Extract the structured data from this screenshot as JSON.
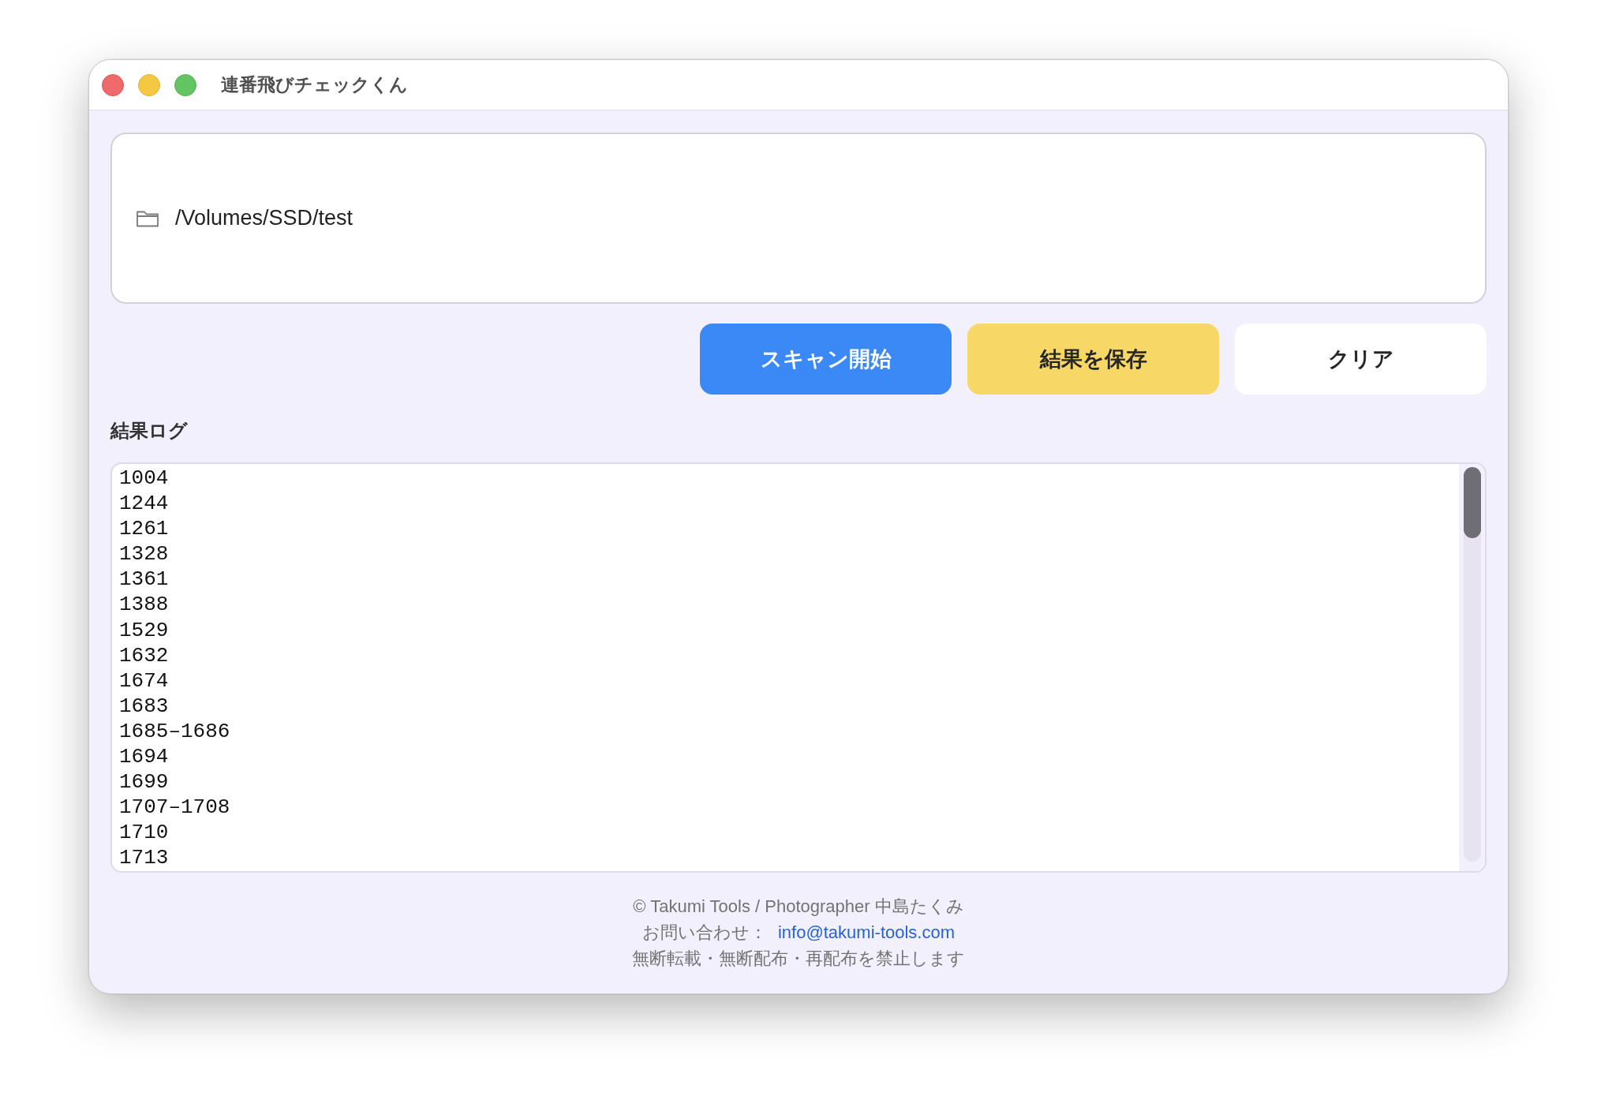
{
  "window": {
    "title": "連番飛びチェックくん"
  },
  "folder_field": {
    "value": "/Volumes/SSD/test"
  },
  "buttons": [
    {
      "label": "スキャン開始",
      "kind": "primary"
    },
    {
      "label": "結果を保存",
      "kind": "save"
    },
    {
      "label": "クリア",
      "kind": "plain"
    }
  ],
  "log": {
    "title": "結果ログ",
    "lines": [
      "1004",
      "1244",
      "1261",
      "1328",
      "1361",
      "1388",
      "1529",
      "1632",
      "1674",
      "1683",
      "1685–1686",
      "1694",
      "1699",
      "1707–1708",
      "1710",
      "1713"
    ]
  },
  "footer": {
    "copyright": "© Takumi Tools / Photographer 中島たくみ",
    "contact_label": "お問い合わせ：",
    "email": "info@takumi-tools.com",
    "notice": "無断転載・無断配布・再配布を禁止します"
  }
}
